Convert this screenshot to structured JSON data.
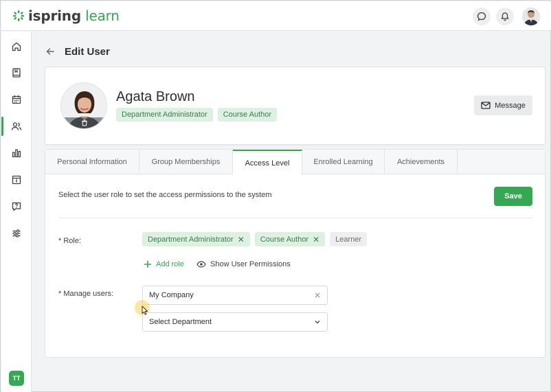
{
  "brand": {
    "name_bold": "ispring",
    "name_light": " learn",
    "accent": "#34a853"
  },
  "topbar": {
    "chat_icon": "chat-bubble-icon",
    "bell_icon": "bell-icon"
  },
  "sidebar": {
    "items": [
      {
        "icon": "home-icon"
      },
      {
        "icon": "book-icon"
      },
      {
        "icon": "calendar-icon"
      },
      {
        "icon": "users-icon",
        "active": true
      },
      {
        "icon": "bar-chart-icon"
      },
      {
        "icon": "info-panel-icon"
      },
      {
        "icon": "question-chat-icon"
      },
      {
        "icon": "sliders-icon"
      }
    ],
    "user_initials": "TT"
  },
  "page": {
    "title": "Edit User"
  },
  "profile": {
    "name": "Agata Brown",
    "roles": [
      "Department Administrator",
      "Course Author"
    ],
    "message_label": "Message"
  },
  "tabs": [
    {
      "label": "Personal Information"
    },
    {
      "label": "Group Memberships"
    },
    {
      "label": "Access Level",
      "active": true
    },
    {
      "label": "Enrolled Learning"
    },
    {
      "label": "Achievements"
    }
  ],
  "access": {
    "hint": "Select the user role to set the access permissions to the system",
    "save_label": "Save",
    "role_label": "* Role:",
    "role_chips": [
      "Department Administrator",
      "Course Author"
    ],
    "role_available": "Learner",
    "add_role_label": "Add role",
    "show_permissions_label": "Show User Permissions",
    "manage_users_label": "* Manage users:",
    "company_value": "My Company",
    "department_placeholder": "Select Department"
  }
}
